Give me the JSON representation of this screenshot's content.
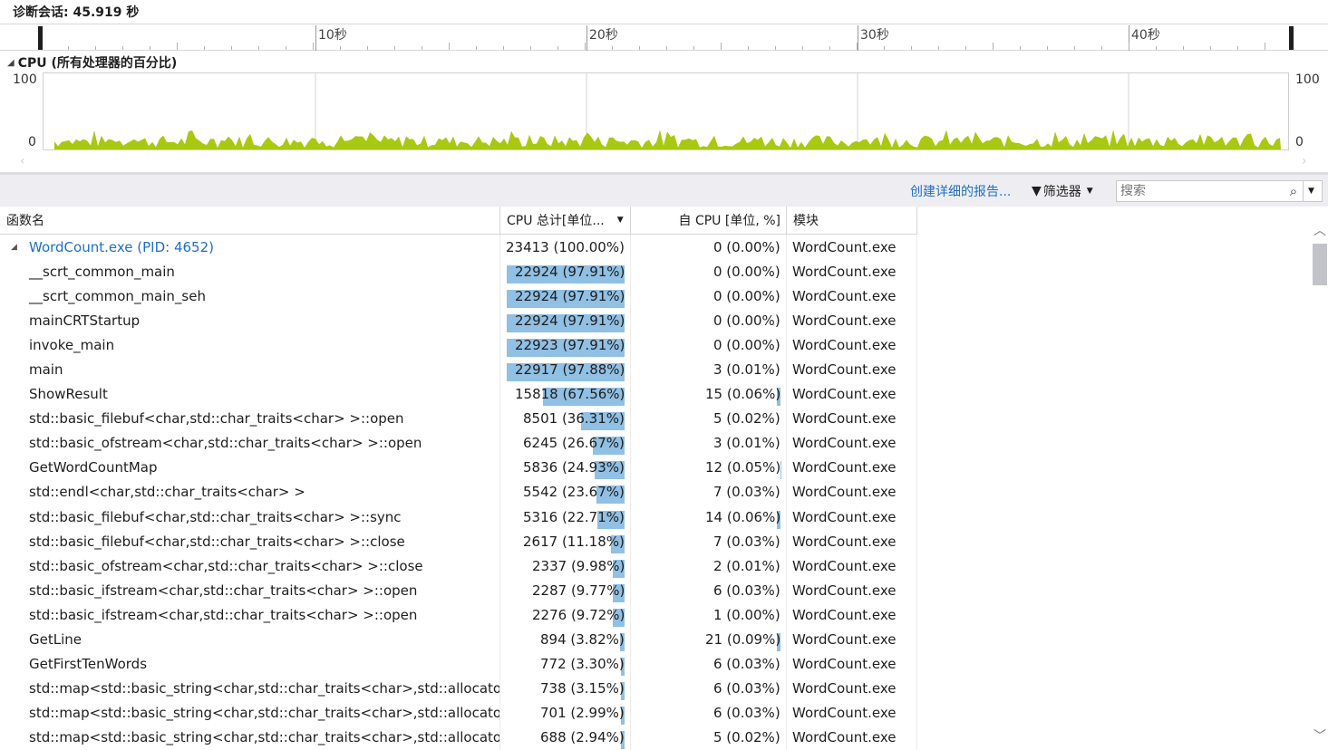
{
  "session": {
    "title": "诊断会话: 45.919 秒"
  },
  "ruler": {
    "labels": [
      "10秒",
      "20秒",
      "30秒",
      "40秒"
    ]
  },
  "cpu": {
    "header": "CPU (所有处理器的百分比)",
    "ymax_left": "100",
    "ymin_left": "0",
    "ymax_right": "100",
    "ymin_right": "0",
    "fill_color": "#a8c90f"
  },
  "toolbar": {
    "report_link": "创建详细的报告...",
    "filter_label": "筛选器",
    "search_placeholder": "搜索"
  },
  "table": {
    "columns": [
      "函数名",
      "CPU 总计[单位...",
      "自 CPU [单位, %]",
      "模块"
    ],
    "rows": [
      {
        "name": "WordCount.exe (PID: 4652)",
        "total": "23413 (100.00%)",
        "total_pct": 100.0,
        "self": "0 (0.00%)",
        "self_pct": 0.0,
        "module": "WordCount.exe"
      },
      {
        "name": "__scrt_common_main",
        "total": "22924 (97.91%)",
        "total_pct": 97.91,
        "self": "0 (0.00%)",
        "self_pct": 0.0,
        "module": "WordCount.exe"
      },
      {
        "name": "__scrt_common_main_seh",
        "total": "22924 (97.91%)",
        "total_pct": 97.91,
        "self": "0 (0.00%)",
        "self_pct": 0.0,
        "module": "WordCount.exe"
      },
      {
        "name": "mainCRTStartup",
        "total": "22924 (97.91%)",
        "total_pct": 97.91,
        "self": "0 (0.00%)",
        "self_pct": 0.0,
        "module": "WordCount.exe"
      },
      {
        "name": "invoke_main",
        "total": "22923 (97.91%)",
        "total_pct": 97.91,
        "self": "0 (0.00%)",
        "self_pct": 0.0,
        "module": "WordCount.exe"
      },
      {
        "name": "main",
        "total": "22917 (97.88%)",
        "total_pct": 97.88,
        "self": "3 (0.01%)",
        "self_pct": 0.01,
        "module": "WordCount.exe"
      },
      {
        "name": "ShowResult",
        "total": "15818 (67.56%)",
        "total_pct": 67.56,
        "self": "15 (0.06%)",
        "self_pct": 0.06,
        "module": "WordCount.exe"
      },
      {
        "name": "std::basic_filebuf<char,std::char_traits<char> >::open",
        "total": "8501 (36.31%)",
        "total_pct": 36.31,
        "self": "5 (0.02%)",
        "self_pct": 0.02,
        "module": "WordCount.exe"
      },
      {
        "name": "std::basic_ofstream<char,std::char_traits<char> >::open",
        "total": "6245 (26.67%)",
        "total_pct": 26.67,
        "self": "3 (0.01%)",
        "self_pct": 0.01,
        "module": "WordCount.exe"
      },
      {
        "name": "GetWordCountMap",
        "total": "5836 (24.93%)",
        "total_pct": 24.93,
        "self": "12 (0.05%)",
        "self_pct": 0.05,
        "module": "WordCount.exe"
      },
      {
        "name": "std::endl<char,std::char_traits<char> >",
        "total": "5542 (23.67%)",
        "total_pct": 23.67,
        "self": "7 (0.03%)",
        "self_pct": 0.03,
        "module": "WordCount.exe"
      },
      {
        "name": "std::basic_filebuf<char,std::char_traits<char> >::sync",
        "total": "5316 (22.71%)",
        "total_pct": 22.71,
        "self": "14 (0.06%)",
        "self_pct": 0.06,
        "module": "WordCount.exe"
      },
      {
        "name": "std::basic_filebuf<char,std::char_traits<char> >::close",
        "total": "2617 (11.18%)",
        "total_pct": 11.18,
        "self": "7 (0.03%)",
        "self_pct": 0.03,
        "module": "WordCount.exe"
      },
      {
        "name": "std::basic_ofstream<char,std::char_traits<char> >::close",
        "total": "2337 (9.98%)",
        "total_pct": 9.98,
        "self": "2 (0.01%)",
        "self_pct": 0.01,
        "module": "WordCount.exe"
      },
      {
        "name": "std::basic_ifstream<char,std::char_traits<char> >::open",
        "total": "2287 (9.77%)",
        "total_pct": 9.77,
        "self": "6 (0.03%)",
        "self_pct": 0.03,
        "module": "WordCount.exe"
      },
      {
        "name": "std::basic_ifstream<char,std::char_traits<char> >::open",
        "total": "2276 (9.72%)",
        "total_pct": 9.72,
        "self": "1 (0.00%)",
        "self_pct": 0.0,
        "module": "WordCount.exe"
      },
      {
        "name": "GetLine",
        "total": "894 (3.82%)",
        "total_pct": 3.82,
        "self": "21 (0.09%)",
        "self_pct": 0.09,
        "module": "WordCount.exe"
      },
      {
        "name": "GetFirstTenWords",
        "total": "772 (3.30%)",
        "total_pct": 3.3,
        "self": "6 (0.03%)",
        "self_pct": 0.03,
        "module": "WordCount.exe"
      },
      {
        "name": "std::map<std::basic_string<char,std::char_traits<char>,std::allocator<c...",
        "total": "738 (3.15%)",
        "total_pct": 3.15,
        "self": "6 (0.03%)",
        "self_pct": 0.03,
        "module": "WordCount.exe"
      },
      {
        "name": "std::map<std::basic_string<char,std::char_traits<char>,std::allocator<c...",
        "total": "701 (2.99%)",
        "total_pct": 2.99,
        "self": "6 (0.03%)",
        "self_pct": 0.03,
        "module": "WordCount.exe"
      },
      {
        "name": "std::map<std::basic_string<char,std::char_traits<char>,std::allocator<c...",
        "total": "688 (2.94%)",
        "total_pct": 2.94,
        "self": "5 (0.02%)",
        "self_pct": 0.02,
        "module": "WordCount.exe"
      }
    ]
  }
}
